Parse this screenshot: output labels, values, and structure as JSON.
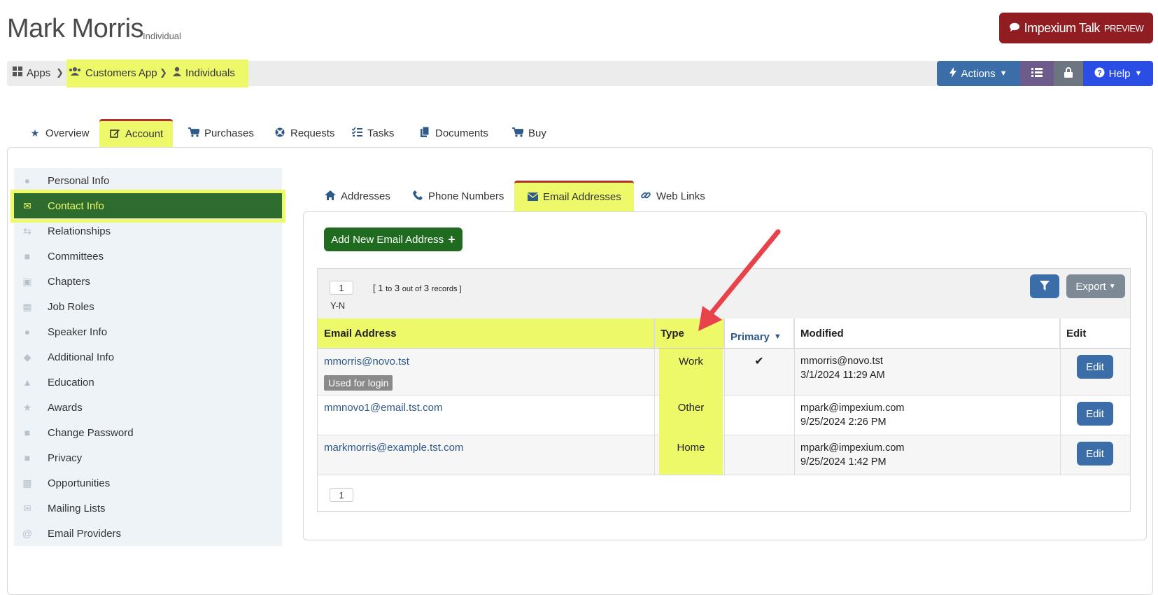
{
  "header": {
    "title": "Mark Morris",
    "subtitle": "Individual",
    "talk_label": "Impexium Talk",
    "talk_badge": "PREVIEW"
  },
  "breadcrumb": {
    "items": [
      "Apps",
      "Customers App",
      "Individuals"
    ]
  },
  "toolbar": {
    "actions_label": "Actions",
    "help_label": "Help"
  },
  "main_tabs": [
    "Overview",
    "Account",
    "Purchases",
    "Requests",
    "Tasks",
    "Documents",
    "Buy"
  ],
  "main_tabs_active": "Account",
  "sidebar": {
    "items": [
      {
        "label": "Personal Info",
        "icon": "user-icon"
      },
      {
        "label": "Contact Info",
        "icon": "envelope-icon"
      },
      {
        "label": "Relationships",
        "icon": "retweet-icon"
      },
      {
        "label": "Committees",
        "icon": "briefcase-icon"
      },
      {
        "label": "Chapters",
        "icon": "archive-icon"
      },
      {
        "label": "Job Roles",
        "icon": "sitemap-icon"
      },
      {
        "label": "Speaker Info",
        "icon": "microphone-icon"
      },
      {
        "label": "Additional Info",
        "icon": "tags-icon"
      },
      {
        "label": "Education",
        "icon": "graduation-cap-icon"
      },
      {
        "label": "Awards",
        "icon": "trophy-icon"
      },
      {
        "label": "Change Password",
        "icon": "lock-icon"
      },
      {
        "label": "Privacy",
        "icon": "lock-icon"
      },
      {
        "label": "Opportunities",
        "icon": "building-icon"
      },
      {
        "label": "Mailing Lists",
        "icon": "envelope-icon"
      },
      {
        "label": "Email Providers",
        "icon": "at-icon"
      }
    ],
    "active": "Contact Info"
  },
  "sub_tabs": [
    "Addresses",
    "Phone Numbers",
    "Email Addresses",
    "Web Links"
  ],
  "sub_tabs_active": "Email Addresses",
  "add_button_label": "Add New Email Address",
  "grid": {
    "page": "1",
    "records_prefix": "[ 1",
    "records_to": "to",
    "records_mid": "3",
    "records_outof": "out of",
    "records_total": "3",
    "records_suffix": "records ]",
    "yn": "Y-N",
    "export_label": "Export",
    "columns": [
      "Email Address",
      "Type",
      "Primary",
      "Modified",
      "Edit"
    ],
    "rows": [
      {
        "email": "mmorris@novo.tst",
        "badge": "Used for login",
        "type": "Work",
        "primary": "✔",
        "modified_by": "mmorris@novo.tst",
        "modified_at": "3/1/2024 11:29 AM",
        "edit": "Edit"
      },
      {
        "email": "mmnovo1@email.tst.com",
        "badge": "",
        "type": "Other",
        "primary": "",
        "modified_by": "mpark@impexium.com",
        "modified_at": "9/25/2024 2:26 PM",
        "edit": "Edit"
      },
      {
        "email": "markmorris@example.tst.com",
        "badge": "",
        "type": "Home",
        "primary": "",
        "modified_by": "mpark@impexium.com",
        "modified_at": "9/25/2024 1:42 PM",
        "edit": "Edit"
      }
    ],
    "bottom_page": "1"
  },
  "colors": {
    "highlight": "#eef96a",
    "active_sidebar": "#2e6b2e",
    "primary_blue": "#3b6ea8",
    "talk_red": "#8f1d22",
    "add_green": "#1f6b1f",
    "annotation_arrow": "#e8424a"
  }
}
